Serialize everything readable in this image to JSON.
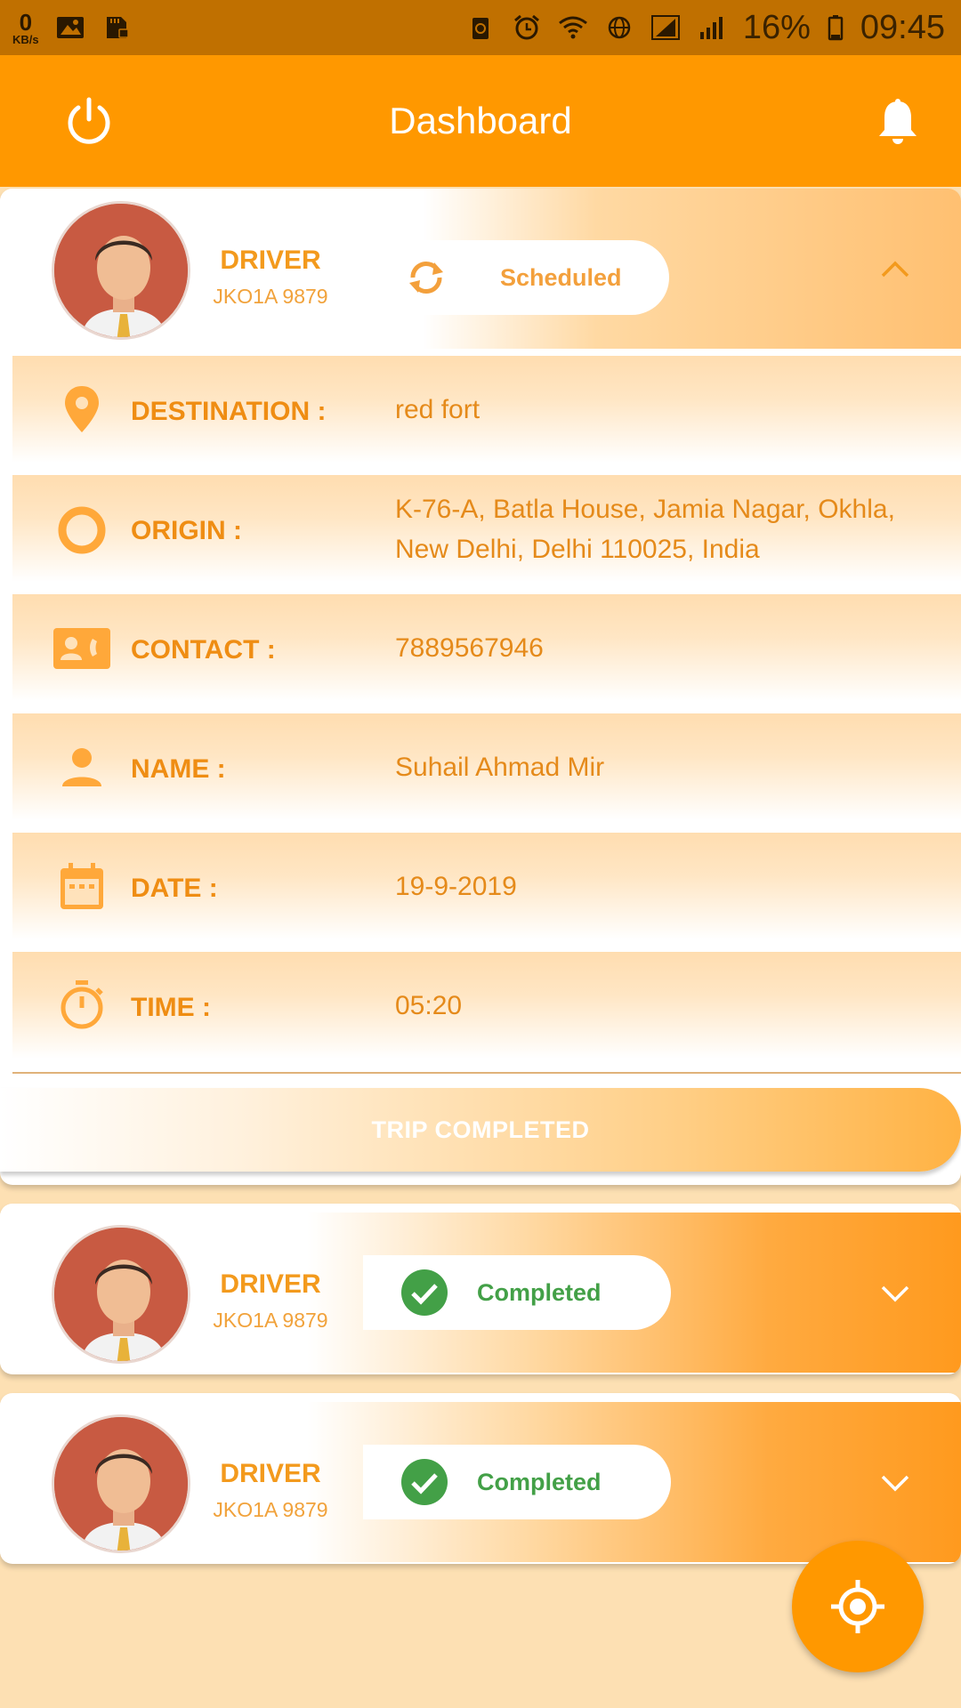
{
  "status_bar": {
    "speed_value": "0",
    "speed_unit": "KB/s",
    "battery": "16%",
    "time": "09:45"
  },
  "app_bar": {
    "title": "Dashboard"
  },
  "trips": [
    {
      "role": "DRIVER",
      "plate": "JKO1A 9879",
      "status": "Scheduled",
      "status_color": "#f3a03c",
      "expanded": true,
      "details": {
        "destination_label": "DESTINATION :",
        "destination": "red fort",
        "origin_label": "ORIGIN :",
        "origin_line1": "K-76-A, Batla House, Jamia Nagar, Okhla,",
        "origin_line2": "New Delhi, Delhi 110025, India",
        "contact_label": "CONTACT :",
        "contact": "7889567946",
        "name_label": "NAME :",
        "name": "Suhail Ahmad Mir",
        "date_label": "DATE :",
        "date": "19-9-2019",
        "time_label": "TIME :",
        "time": "05:20"
      },
      "action_label": "TRIP COMPLETED"
    },
    {
      "role": "DRIVER",
      "plate": "JKO1A 9879",
      "status": "Completed",
      "status_color": "#43a047",
      "expanded": false
    },
    {
      "role": "DRIVER",
      "plate": "JKO1A 9879",
      "status": "Completed",
      "status_color": "#43a047",
      "expanded": false
    }
  ],
  "colors": {
    "primary": "#ff9800",
    "status_bar": "#c07000",
    "background": "#fde0b3",
    "accent_text": "#ef8d13",
    "success": "#43a047"
  },
  "icons": [
    "power-icon",
    "bell-icon",
    "sync-icon",
    "chevron-up-icon",
    "location-pin-icon",
    "origin-circle-icon",
    "contact-card-icon",
    "person-icon",
    "calendar-icon",
    "stopwatch-icon",
    "check-circle-icon",
    "chevron-down-icon",
    "gps-target-icon"
  ]
}
